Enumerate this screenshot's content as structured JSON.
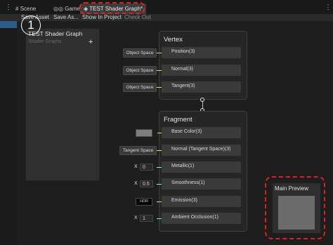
{
  "tabs": [
    {
      "label": "Scene",
      "icon": "scene-grid-icon"
    },
    {
      "label": "Game",
      "icon": "game-controller-icon"
    },
    {
      "label": "TEST Shader Graph*",
      "icon": "shader-graph-icon",
      "active": true
    }
  ],
  "toolbar": {
    "save_asset": "Save Asset",
    "save_as": "Save As...",
    "show_in_project": "Show In Project",
    "check_out": "Check Out"
  },
  "blackboard": {
    "title": "TEST Shader Graph",
    "subtitle": "Shader Graphs",
    "add_label": "+"
  },
  "vertex": {
    "title": "Vertex",
    "slots": [
      {
        "label": "Position(3)",
        "input": "Object Space",
        "port_color": "yellow"
      },
      {
        "label": "Normal(3)",
        "input": "Object Space",
        "port_color": "yellow"
      },
      {
        "label": "Tangent(3)",
        "input": "Object Space",
        "port_color": "yellow"
      }
    ]
  },
  "fragment": {
    "title": "Fragment",
    "slots": [
      {
        "label": "Base Color(3)",
        "input_type": "color",
        "port_color": "yellow"
      },
      {
        "label": "Normal (Tangent Space)(3)",
        "input": "Tangent Space",
        "port_color": "yellow"
      },
      {
        "label": "Metallic(1)",
        "axis": "X",
        "value": "0",
        "port_color": "cyan"
      },
      {
        "label": "Smoothness(1)",
        "axis": "X",
        "value": "0.5",
        "port_color": "cyan"
      },
      {
        "label": "Emission(3)",
        "input": "HDR",
        "port_color": "yellow"
      },
      {
        "label": "Ambient Occlusion(1)",
        "axis": "X",
        "value": "1",
        "port_color": "cyan"
      }
    ]
  },
  "preview": {
    "title": "Main Preview"
  },
  "annotation": {
    "number": "1"
  },
  "colors": {
    "port_yellow": "#e4db72",
    "port_cyan": "#84e4e7",
    "annotation_red": "#e21f1f",
    "selection_blue": "#2c5d87"
  }
}
